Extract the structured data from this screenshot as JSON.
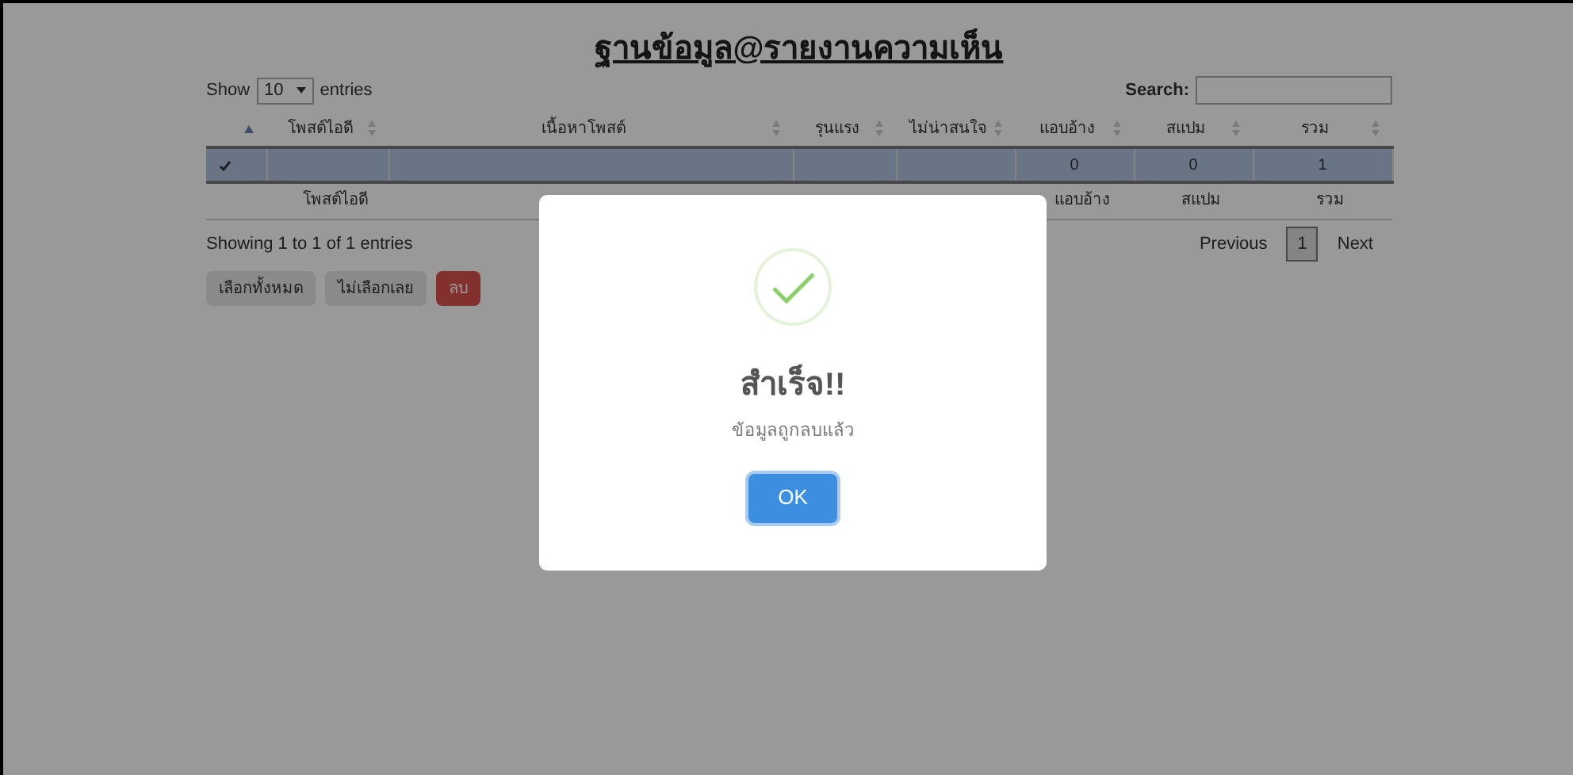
{
  "page": {
    "title": "ฐานข้อมูล@รายงานความเห็น"
  },
  "length_control": {
    "prefix": "Show",
    "value": "10",
    "suffix": "entries"
  },
  "search": {
    "label": "Search:"
  },
  "table": {
    "columns": [
      {
        "sorted": true
      },
      {
        "label": "โพสต์ไอดี",
        "sorted": false,
        "footer": "โพสต์ไอดี"
      },
      {
        "label": "เนื้อหาโพสต์",
        "sorted": false
      },
      {
        "label": "รุนแรง",
        "sorted": false
      },
      {
        "label": "ไม่น่าสนใจ",
        "sorted": false
      },
      {
        "label": "แอบอ้าง",
        "sorted": false,
        "footer": "แอบอ้าง"
      },
      {
        "label": "สแปม",
        "sorted": false,
        "footer": "สแปม"
      },
      {
        "label": "รวม",
        "sorted": false,
        "footer": "รวม"
      }
    ],
    "rows": [
      {
        "selected": true,
        "cells": [
          null,
          null,
          null,
          null,
          null,
          "0",
          "0",
          "1"
        ]
      }
    ]
  },
  "info": "Showing 1 to 1 of 1 entries",
  "pagination": {
    "previous": "Previous",
    "pages": [
      {
        "label": "1",
        "selected": true
      }
    ],
    "next": "Next"
  },
  "actions": [
    {
      "label": "เลือกทั้งหมด",
      "kind": "default"
    },
    {
      "label": "ไม่เลือกเลย",
      "kind": "default"
    },
    {
      "label": "ลบ",
      "kind": "danger"
    }
  ],
  "dialog": {
    "title": "สำเร็จ!!",
    "message": "ข้อมูลถูกลบแล้ว",
    "button": "OK"
  }
}
